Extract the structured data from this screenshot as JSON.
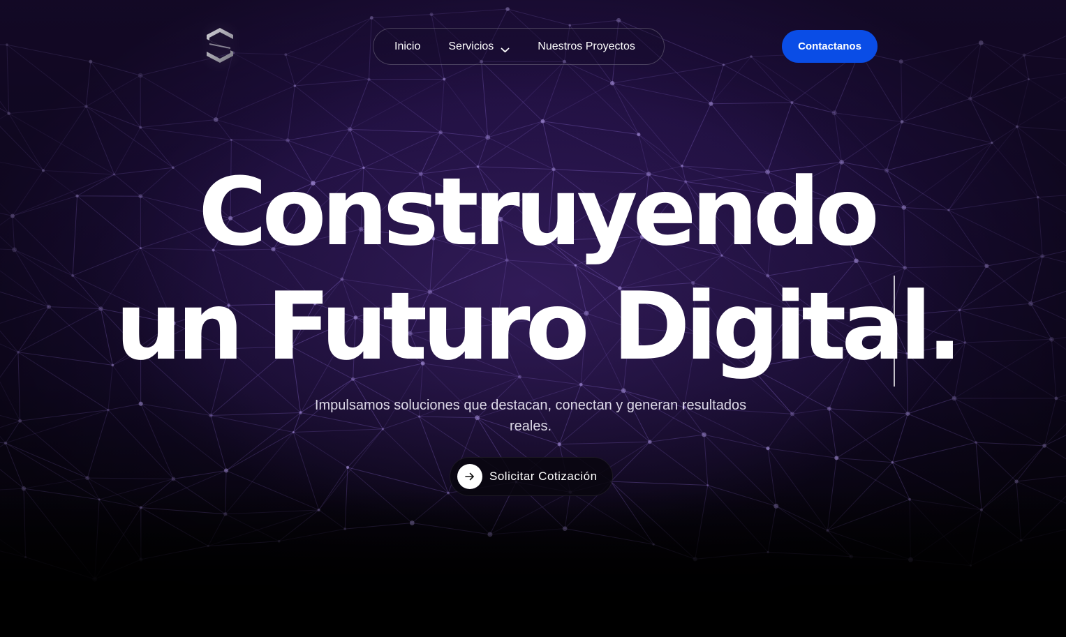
{
  "header": {
    "logo_icon": "stacked-s-logo-icon",
    "nav": [
      {
        "label": "Inicio"
      },
      {
        "label": "Servicios",
        "has_dropdown": true,
        "icon": "chevron-down-icon"
      },
      {
        "label": "Nuestros Proyectos"
      }
    ],
    "cta_label": "Contactanos"
  },
  "hero": {
    "headline_line1": "Construyendo",
    "headline_line2": "un Futuro Digital.",
    "subtitle": "Impulsamos soluciones que destacan, conectan y generan resultados reales.",
    "quote_button_label": "Solicitar Cotización",
    "quote_button_icon": "arrow-right-icon"
  },
  "colors": {
    "cta_blue": "#0a4de6",
    "background_purple": "#1b0d38",
    "mesh_lines": "#8a6ad0"
  }
}
